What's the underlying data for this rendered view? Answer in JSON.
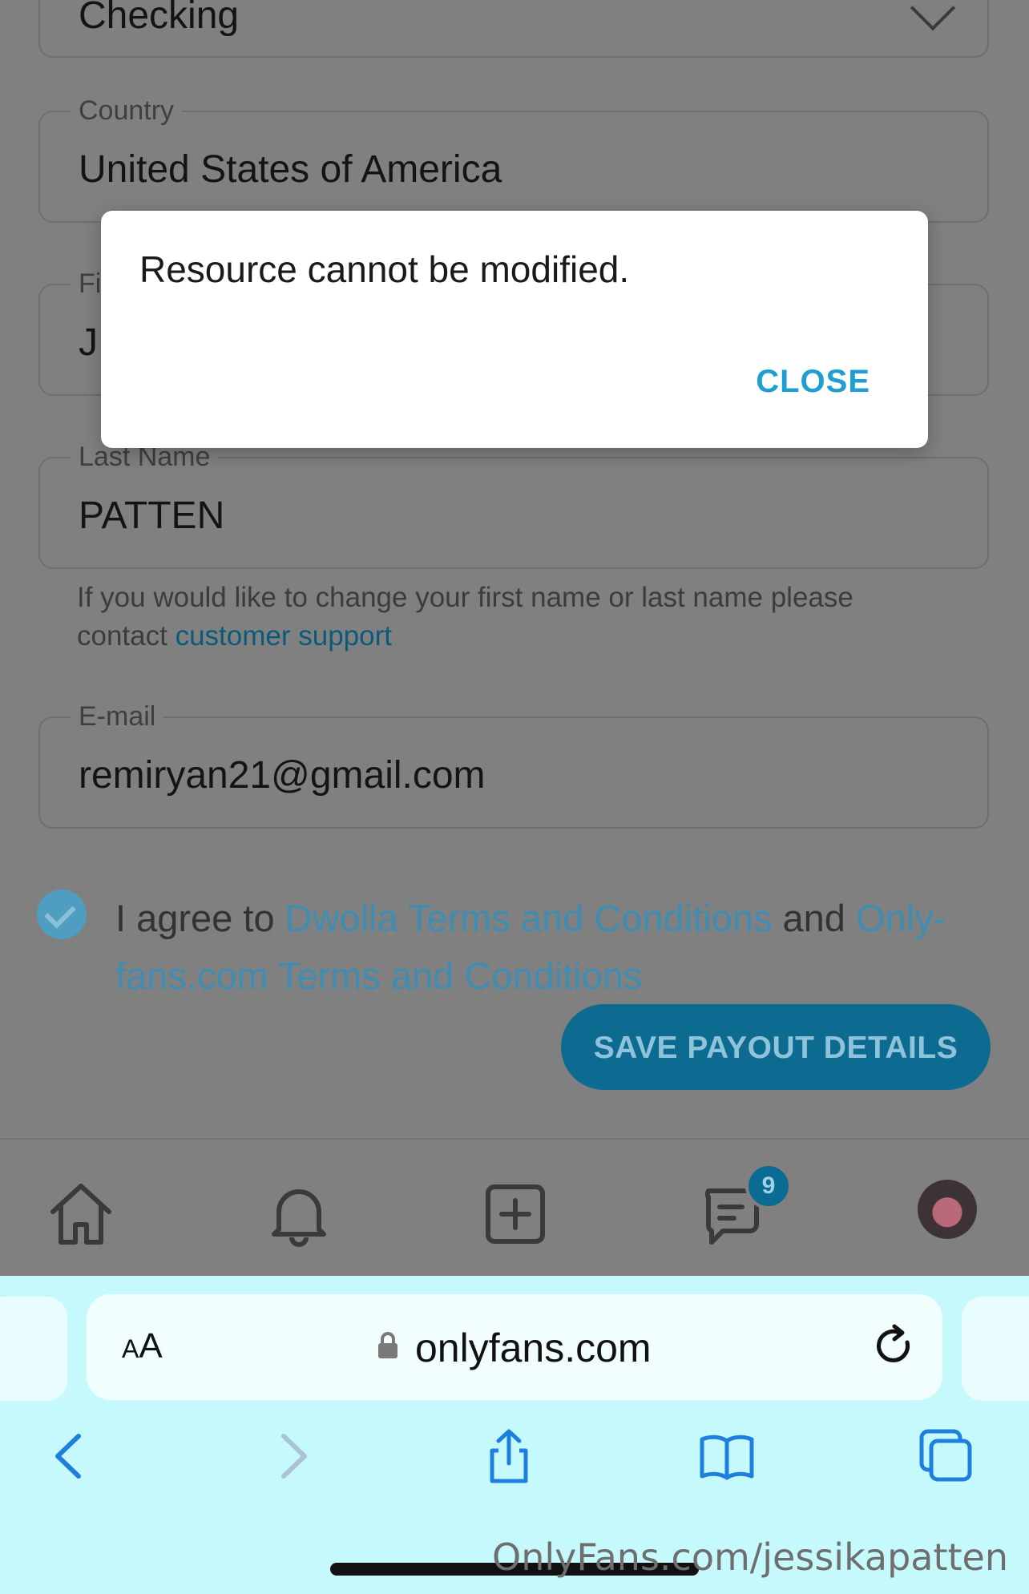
{
  "form": {
    "account_type_value": "Checking",
    "country": {
      "label": "Country",
      "value": "United States of America"
    },
    "first_name": {
      "label": "Fi",
      "value": "J"
    },
    "last_name": {
      "label": "Last Name",
      "value": "PATTEN"
    },
    "helper_text": "If you would like to change your first name or last name please contact",
    "helper_link": "customer support",
    "email": {
      "label": "E-mail",
      "value": "remiryan21@gmail.com"
    },
    "agree": {
      "prefix": "I agree to",
      "link1": "Dwolla Terms and Conditions",
      "middle": "and",
      "link2": "Only-fans.com Terms and Conditions",
      "checked": true
    },
    "save_button": "SAVE PAYOUT DETAILS"
  },
  "tabbar": {
    "items": [
      "home-icon",
      "bell-icon",
      "add-post-icon",
      "messages-icon",
      "avatar"
    ],
    "messages_badge": "9"
  },
  "modal": {
    "message": "Resource cannot be modified.",
    "close_label": "CLOSE"
  },
  "browser": {
    "aa_label_small": "A",
    "aa_label_large": "A",
    "url": "onlyfans.com",
    "nav": [
      "back-icon",
      "forward-icon",
      "share-icon",
      "bookmarks-icon",
      "tabs-icon"
    ]
  },
  "watermark": "OnlyFans.com/jessikapatten",
  "colors": {
    "accent": "#1e9ed2",
    "dim_overlay": "#808080",
    "browser_bar": "#c6f9fb"
  }
}
